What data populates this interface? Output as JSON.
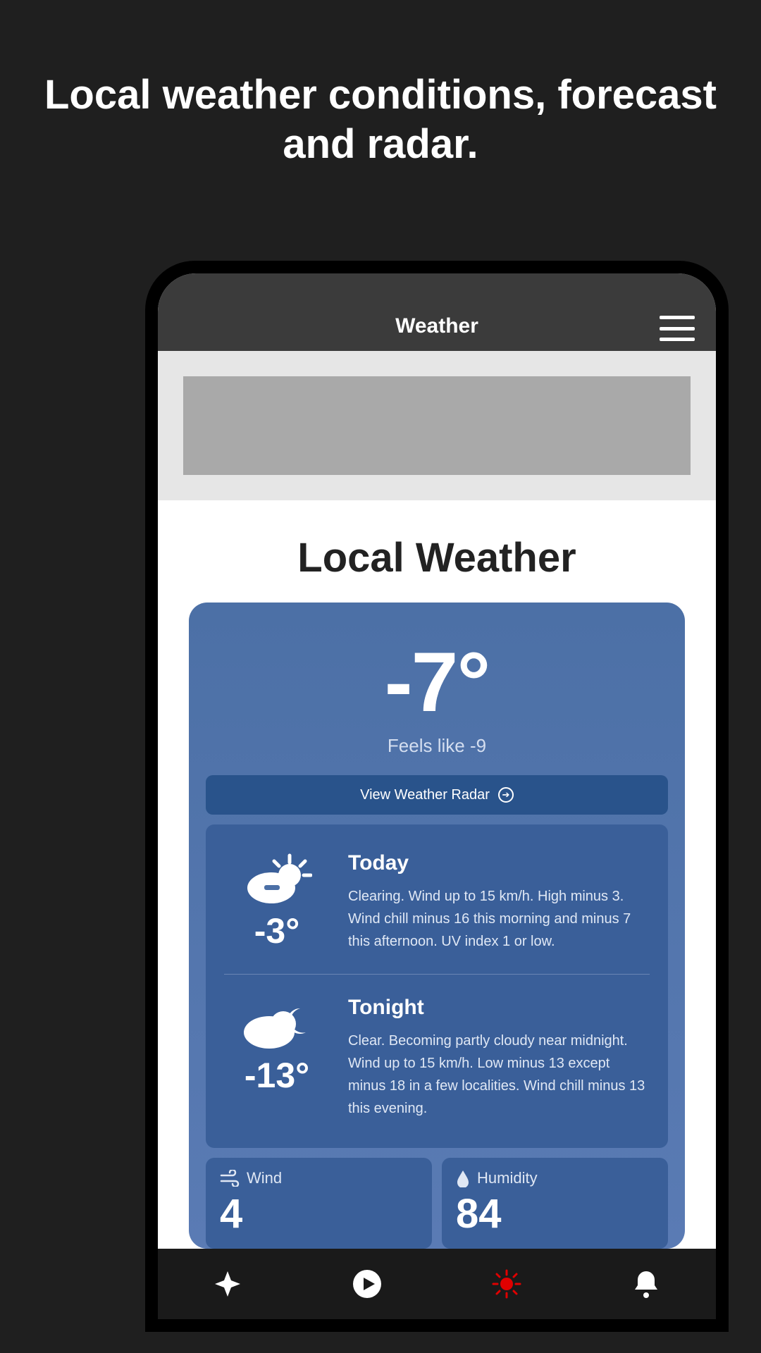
{
  "promo": {
    "headline": "Local weather conditions, forecast and radar."
  },
  "header": {
    "title": "Weather"
  },
  "page": {
    "title": "Local Weather"
  },
  "current": {
    "temp": "-7°",
    "feels_like": "Feels like -9",
    "radar_label": "View Weather Radar"
  },
  "forecast": [
    {
      "label": "Today",
      "temp": "-3°",
      "icon": "partly-sunny",
      "desc": "Clearing. Wind up to 15 km/h. High minus 3. Wind chill minus 16 this morning and minus 7 this afternoon. UV index 1 or low."
    },
    {
      "label": "Tonight",
      "temp": "-13°",
      "icon": "partly-cloudy-night",
      "desc": "Clear. Becoming partly cloudy near midnight. Wind up to 15 km/h. Low minus 13 except minus 18 in a few localities. Wind chill minus 13 this evening."
    }
  ],
  "stats": {
    "wind": {
      "label": "Wind",
      "value": "4"
    },
    "humidity": {
      "label": "Humidity",
      "value": "84"
    }
  }
}
